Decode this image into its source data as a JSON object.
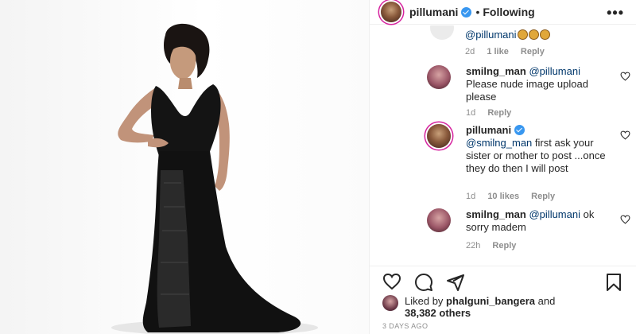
{
  "header": {
    "username": "pillumani",
    "separator": "•",
    "follow_status": "Following",
    "more_label": "•••"
  },
  "thread": {
    "clipped_mention": "@pillumani",
    "clipped_meta": {
      "age": "2d",
      "likes": "1 like",
      "reply": "Reply"
    },
    "comments": [
      {
        "username": "smilng_man",
        "mention": "@pillumani",
        "text": "Please nude image upload please",
        "age": "1d",
        "likes": "",
        "reply": "Reply"
      },
      {
        "username": "pillumani",
        "mention": "@smilng_man",
        "text": "first ask your sister or mother to post ...once they do then I will post",
        "age": "1d",
        "likes": "10 likes",
        "reply": "Reply"
      },
      {
        "username": "smilng_man",
        "mention": "@pillumani",
        "text": "ok sorry madem",
        "age": "22h",
        "likes": "",
        "reply": "Reply"
      }
    ]
  },
  "actions": {
    "icons": [
      "heart-icon",
      "comment-icon",
      "share-icon",
      "bookmark-icon"
    ]
  },
  "likes": {
    "prefix": "Liked by",
    "user": "phalguni_bangera",
    "joiner": "and",
    "count": "38,382 others"
  },
  "posted": "3 DAYS AGO",
  "colors": {
    "verified": "#3897f0",
    "muted": "#8e8e8e",
    "text": "#262626",
    "mention": "#00376b"
  }
}
